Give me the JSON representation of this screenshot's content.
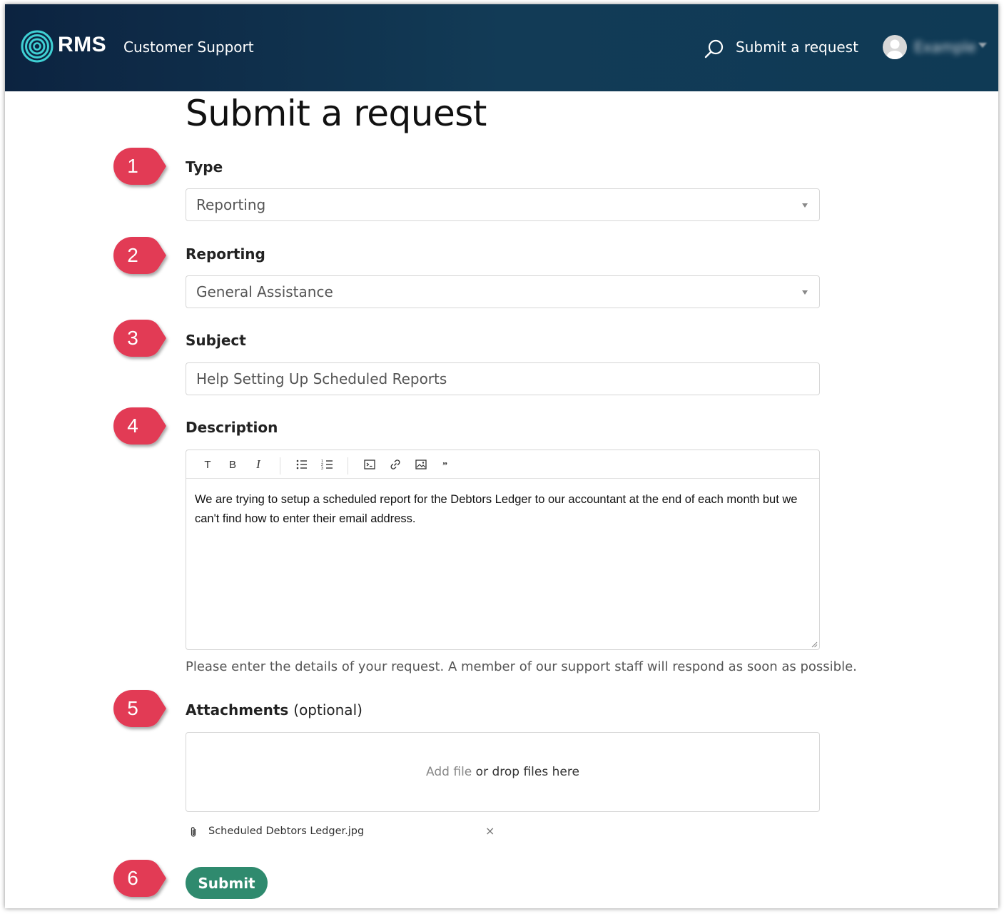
{
  "header": {
    "brand": "RMS",
    "subtitle": "Customer Support",
    "nav_submit": "Submit a request",
    "user_name": "Example"
  },
  "page": {
    "title": "Submit a request"
  },
  "form": {
    "type": {
      "label": "Type",
      "value": "Reporting"
    },
    "reporting": {
      "label": "Reporting",
      "value": "General Assistance"
    },
    "subject": {
      "label": "Subject",
      "value": "Help Setting Up Scheduled Reports"
    },
    "description": {
      "label": "Description",
      "toolbar": [
        "T",
        "B",
        "I",
        "bullet-list-icon",
        "numbered-list-icon",
        "code-icon",
        "link-icon",
        "image-icon",
        "quote-icon"
      ],
      "text": "We are trying to setup a scheduled report for the Debtors Ledger to our accountant at the end of each month but we can't find how to enter their email address.",
      "hint": "Please enter the details of your request. A member of our support staff will respond as soon as possible."
    },
    "attachments": {
      "label": "Attachments",
      "optional": "(optional)",
      "add_file": "Add file",
      "drop_text": "or drop files here",
      "files": [
        {
          "name": "Scheduled Debtors Ledger.jpg"
        }
      ]
    },
    "submit_label": "Submit"
  },
  "callouts": [
    "1",
    "2",
    "3",
    "4",
    "5",
    "6"
  ],
  "colors": {
    "header_bg": "#0c2340",
    "callout": "#e23a55",
    "submit": "#2f8a6e",
    "logo_accent": "#3fd0d4"
  }
}
